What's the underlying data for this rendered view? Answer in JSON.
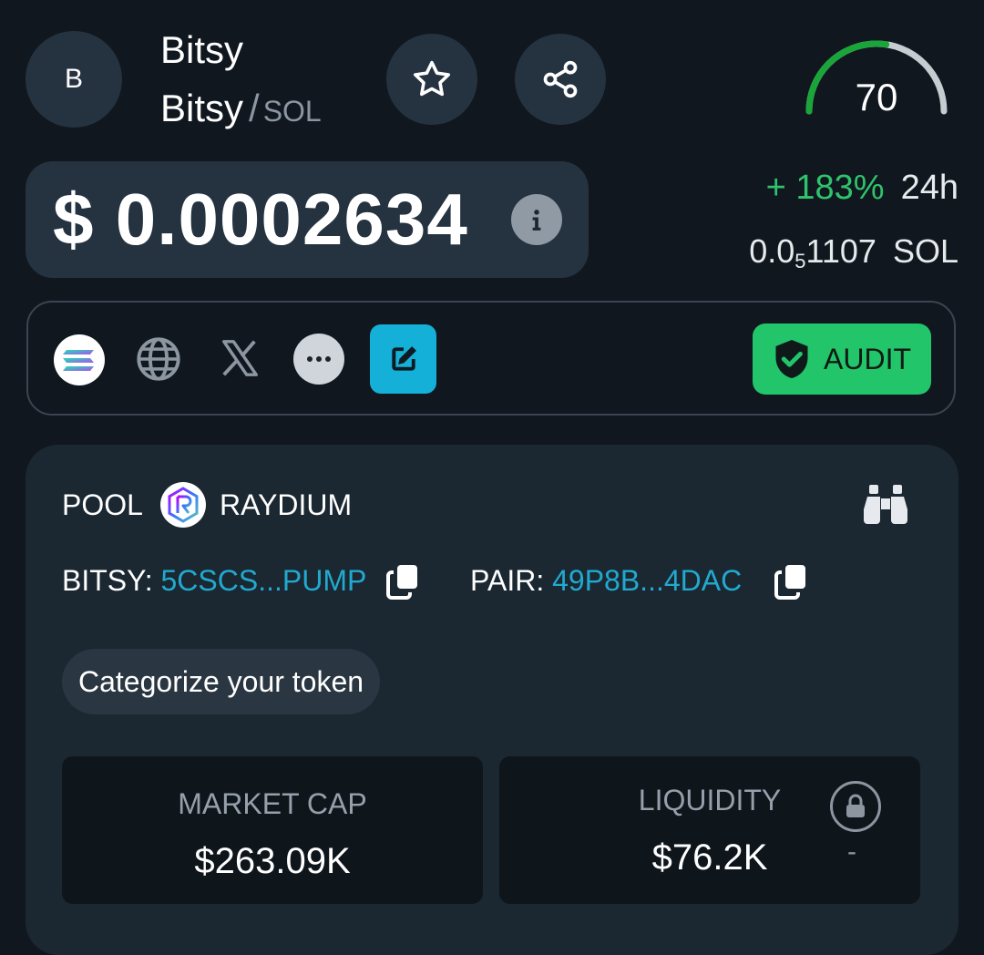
{
  "token": {
    "avatar_letter": "B",
    "name": "Bitsy",
    "symbol": "Bitsy",
    "separator": "/",
    "quote": "SOL"
  },
  "score": {
    "value": "70",
    "fraction": 0.7
  },
  "price": {
    "usd": "$ 0.0002634",
    "change_pct": "+ 183%",
    "change_period": "24h",
    "sol_lead": "0.0",
    "sol_sub": "5",
    "sol_rest": "1107",
    "sol_unit": "SOL"
  },
  "links": {
    "audit_label": "AUDIT"
  },
  "pool": {
    "label": "POOL",
    "dex": "RAYDIUM",
    "token_label": "BITSY:",
    "token_address": "5CSCS...PUMP",
    "pair_label": "PAIR:",
    "pair_address": "49P8B...4DAC",
    "categorize_label": "Categorize your token"
  },
  "stats": {
    "market_cap_label": "MARKET CAP",
    "market_cap_value": "$263.09K",
    "liquidity_label": "LIQUIDITY",
    "liquidity_value": "$76.2K",
    "liquidity_extra": "-"
  },
  "colors": {
    "background": "#10171e",
    "positive": "#2fc36b",
    "link": "#21a9cf",
    "audit": "#22c56a",
    "edit": "#14b0d8"
  }
}
